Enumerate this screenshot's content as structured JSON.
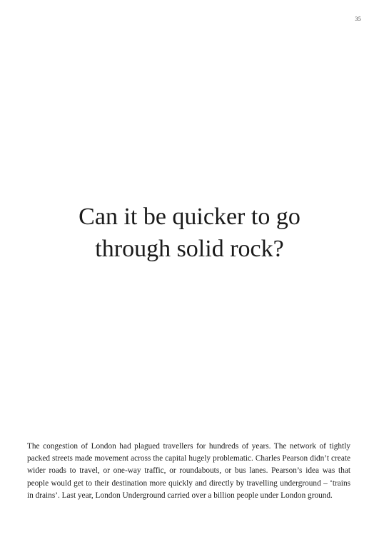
{
  "page": {
    "number": "35"
  },
  "headline": {
    "line1": "Can it be quicker to go",
    "line2": "through solid rock?"
  },
  "body": {
    "paragraph": "The congestion of London had plagued travellers for hundreds of years. The network of tightly packed streets made movement across the capital hugely problematic. Charles Pearson didn’t create wider roads to travel, or one-way traffic, or roundabouts, or bus lanes. Pearson’s idea was that people would get to their destination more quickly and directly by travelling underground – ‘trains in drains’. Last year, London Underground carried over a billion people under London ground."
  }
}
